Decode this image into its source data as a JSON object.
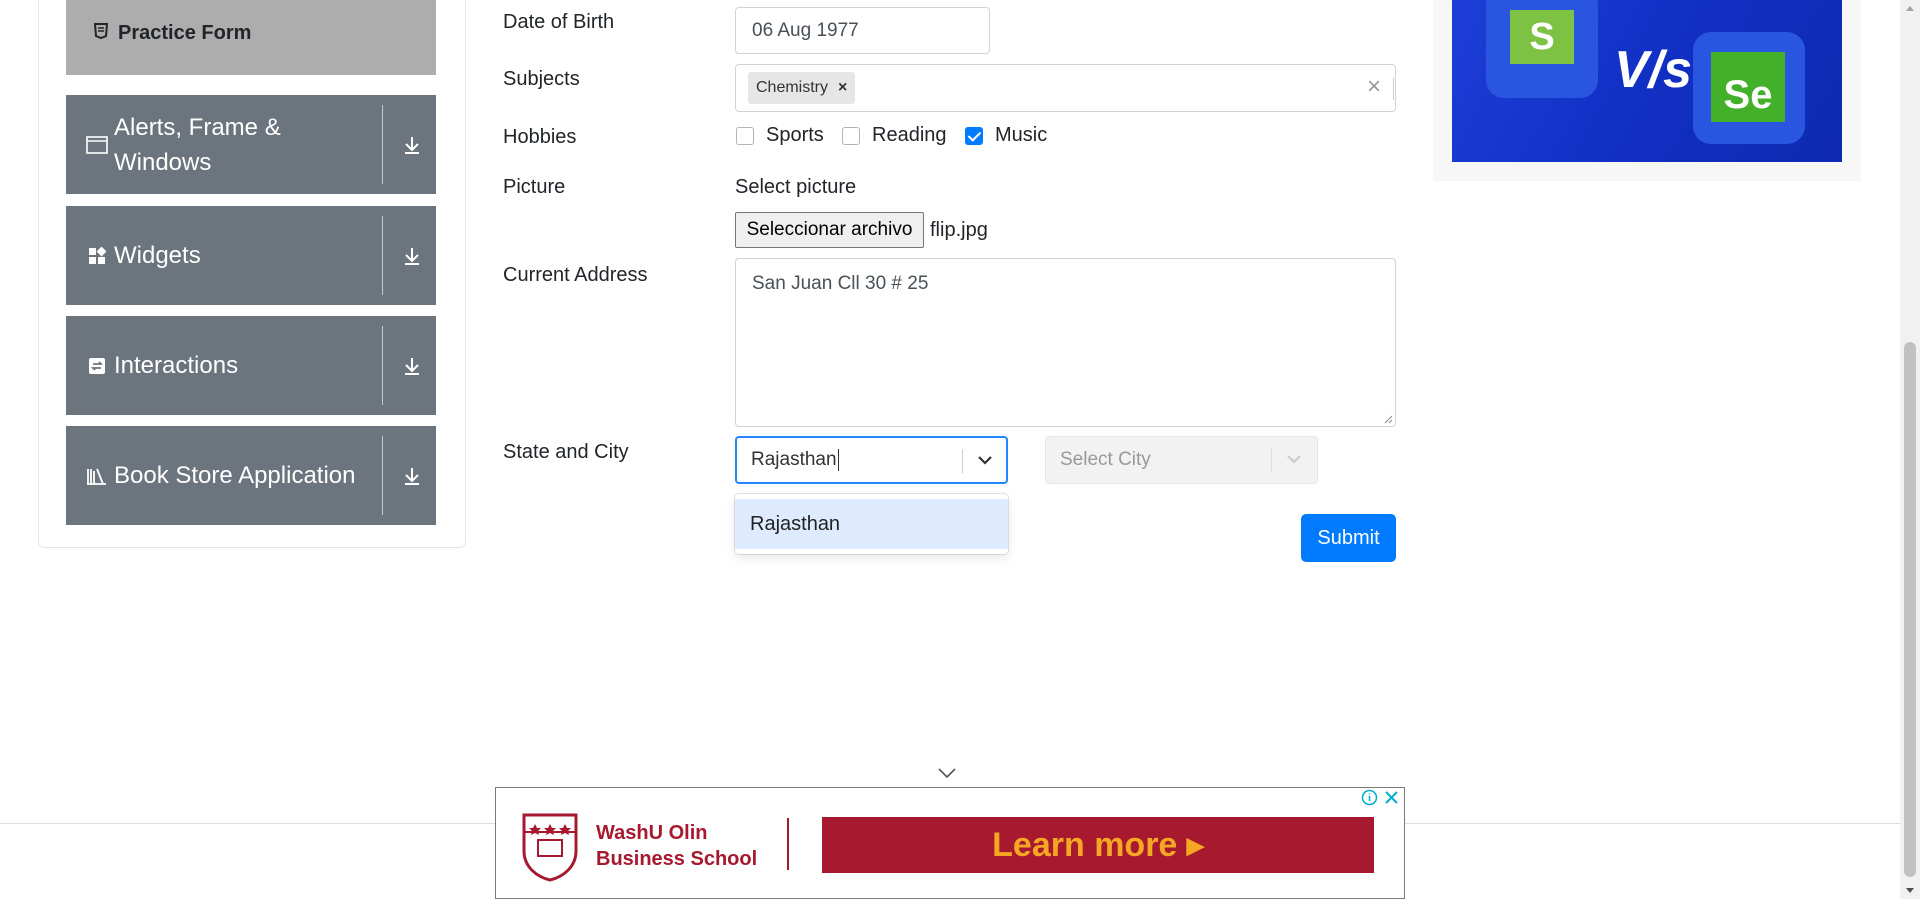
{
  "sidebar": {
    "active_item": "Practice Form",
    "groups": [
      {
        "label": "Alerts, Frame & Windows",
        "icon": "window-icon"
      },
      {
        "label": "Widgets",
        "icon": "widgets-icon"
      },
      {
        "label": "Interactions",
        "icon": "interactions-icon"
      },
      {
        "label": "Book Store Application",
        "icon": "book-icon"
      }
    ]
  },
  "form": {
    "dob": {
      "label": "Date of Birth",
      "value": "06 Aug 1977"
    },
    "subjects": {
      "label": "Subjects",
      "chips": [
        "Chemistry"
      ]
    },
    "hobbies": {
      "label": "Hobbies",
      "options": [
        {
          "label": "Sports",
          "checked": false
        },
        {
          "label": "Reading",
          "checked": false
        },
        {
          "label": "Music",
          "checked": true
        }
      ]
    },
    "picture": {
      "label": "Picture",
      "select_text": "Select picture",
      "button": "Seleccionar archivo",
      "file_name": "flip.jpg"
    },
    "address": {
      "label": "Current Address",
      "value": "San Juan Cll 30 # 25"
    },
    "state_city": {
      "label": "State and City",
      "state_value": "Rajasthan",
      "state_options": [
        "Rajasthan"
      ],
      "city_placeholder": "Select City"
    },
    "submit": "Submit"
  },
  "ad_top": {
    "left_letter": "S",
    "vs": "V/s",
    "right_letters": "Se"
  },
  "ad_bottom": {
    "school_line1": "WashU Olin",
    "school_line2": "Business School",
    "cta": "Learn more ▸",
    "brand_color": "#a6192e",
    "cta_text_color": "#f5a623"
  },
  "colors": {
    "primary": "#007bff",
    "sidebar_group": "#6c757d",
    "active_item": "#adadad"
  }
}
